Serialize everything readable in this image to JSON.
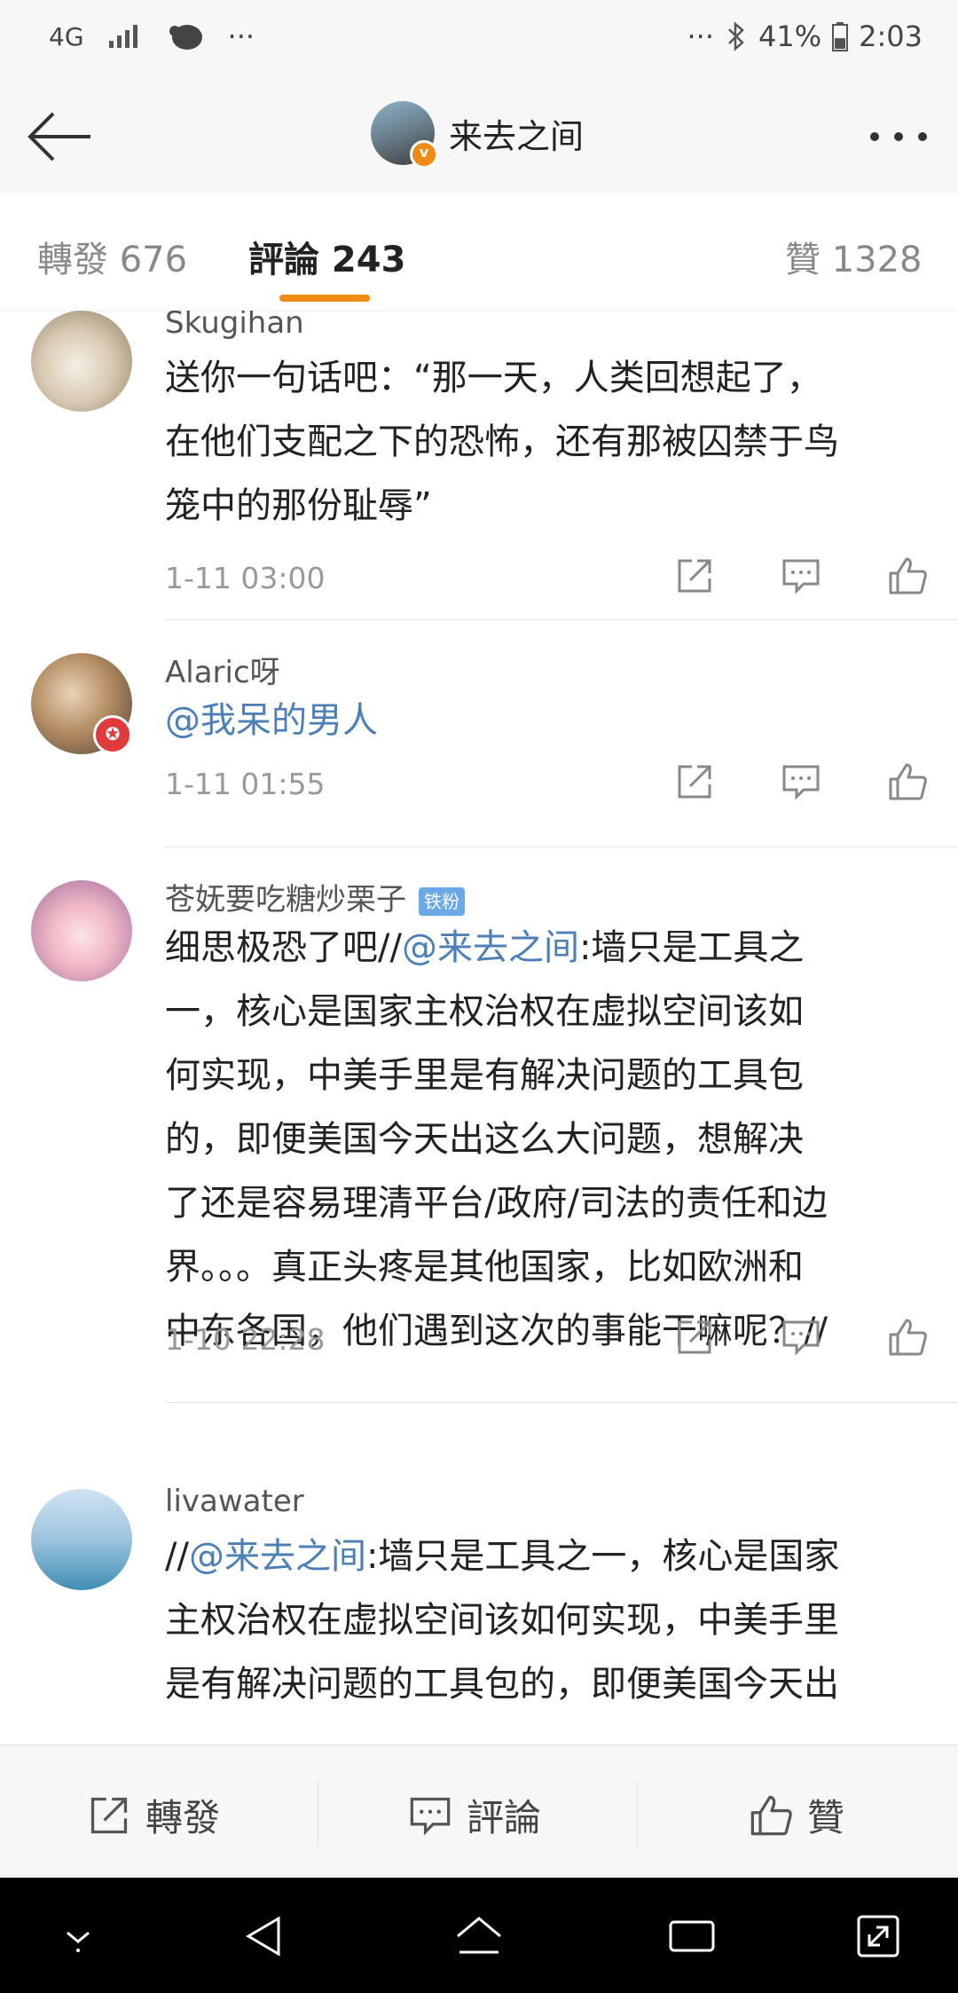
{
  "status_bar": {
    "network": "4G",
    "left_more": "···",
    "right_more": "···",
    "battery": "41%",
    "time": "2:03"
  },
  "nav": {
    "title": "来去之间",
    "back_icon": "arrow-left-icon",
    "more_icon": "more-dots-icon",
    "verified_mark": "v"
  },
  "tabs": [
    {
      "label": "轉發 676"
    },
    {
      "label": "評論 243"
    },
    {
      "label": "贊 1328"
    }
  ],
  "comments": [
    {
      "author": "Skugihan",
      "lines": [
        "送你一句话吧：“那一天，人类回想起了，",
        "在他们支配之下的恐怖，还有那被囚禁于鸟",
        "笼中的那份耻辱”"
      ],
      "time": "1-11 03:00"
    },
    {
      "author": "Alaric呀",
      "mention": "@我呆的男人",
      "time": "1-11 01:55"
    },
    {
      "author": "苍妩要吃糖炒栗子",
      "badge": "铁粉",
      "first_prefix": "细思极恐了吧//",
      "first_mention": "@来去之间",
      "first_suffix": ":墙只是工具之",
      "lines": [
        "一，核心是国家主权治权在虚拟空间该如",
        "何实现，中美手里是有解决问题的工具包",
        "的，即便美国今天出这么大问题，想解决",
        "了还是容易理清平台/政府/司法的责任和边",
        "界。。。真正头疼是其他国家，比如欧洲和",
        "中东各国，他们遇到这次的事能干嘛呢？//"
      ],
      "time": "1-10 22:28"
    },
    {
      "author": "livawater",
      "first_prefix": "//",
      "first_mention": "@来去之间",
      "first_suffix": ":墙只是工具之一，核心是国家",
      "lines": [
        "主权治权在虚拟空间该如何实现，中美手里",
        "是有解决问题的工具包的，即便美国今天出"
      ]
    }
  ],
  "bottom_bar": {
    "repost": "轉發",
    "comment": "評論",
    "like": "贊"
  },
  "colors": {
    "accent": "#f08c14",
    "mention": "#4d7fb5",
    "badge": "#6aa8e8"
  }
}
